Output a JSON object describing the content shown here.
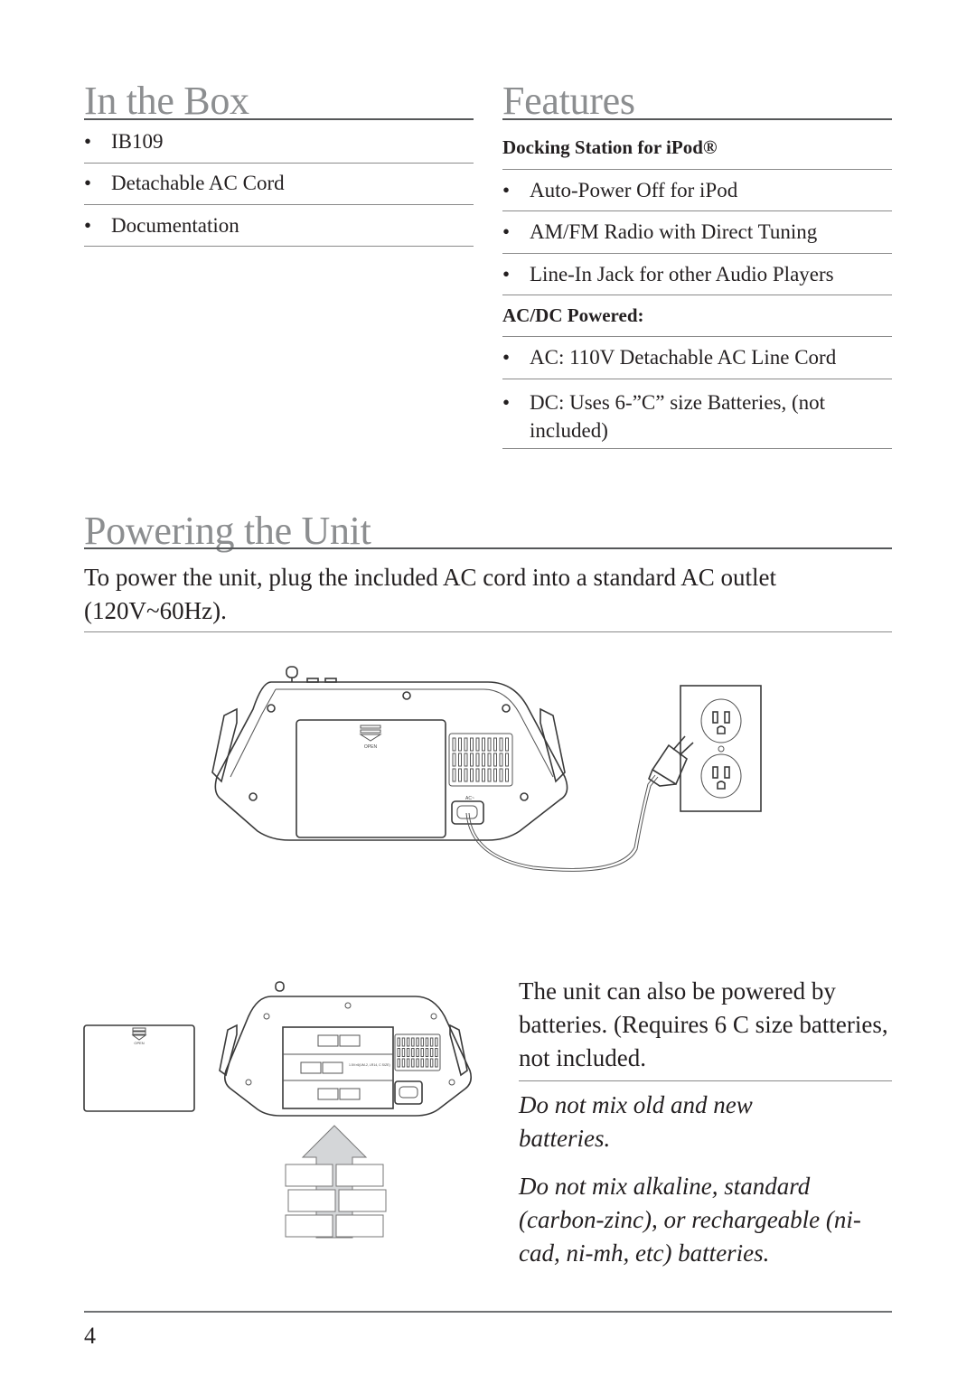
{
  "in_the_box": {
    "title": "In the Box",
    "items": [
      "IB109",
      "Detachable AC Cord",
      "Documentation"
    ]
  },
  "features": {
    "title": "Features",
    "groups": [
      {
        "heading": "Docking Station for iPod®",
        "items": [
          "Auto-Power Off for iPod",
          "AM/FM Radio with Direct Tuning",
          "Line-In Jack for other Audio Players"
        ]
      },
      {
        "heading": "AC/DC Powered:",
        "items": [
          "AC: 110V Detachable AC Line Cord",
          "DC: Uses 6-”C” size Batteries, (not included)"
        ]
      }
    ]
  },
  "powering": {
    "title": "Powering the Unit",
    "intro": "To power the unit, plug the included AC cord into a standard AC outlet (120V~60Hz).",
    "battery_text": "The unit can also be powered by batteries. (Requires 6 C size batteries, not included.",
    "warnings": [
      "Do not mix old and new batteries.",
      "Do not mix alkaline, standard (carbon-zinc), or rechargeable (ni-cad, ni-mh, etc) batteries."
    ]
  },
  "illustrations": {
    "open_label": "OPEN",
    "ac_label": "AC~",
    "battery_label": "1.5V×6(UM-2, LR14, C SIZE)"
  },
  "bullet": "•",
  "page_number": "4"
}
